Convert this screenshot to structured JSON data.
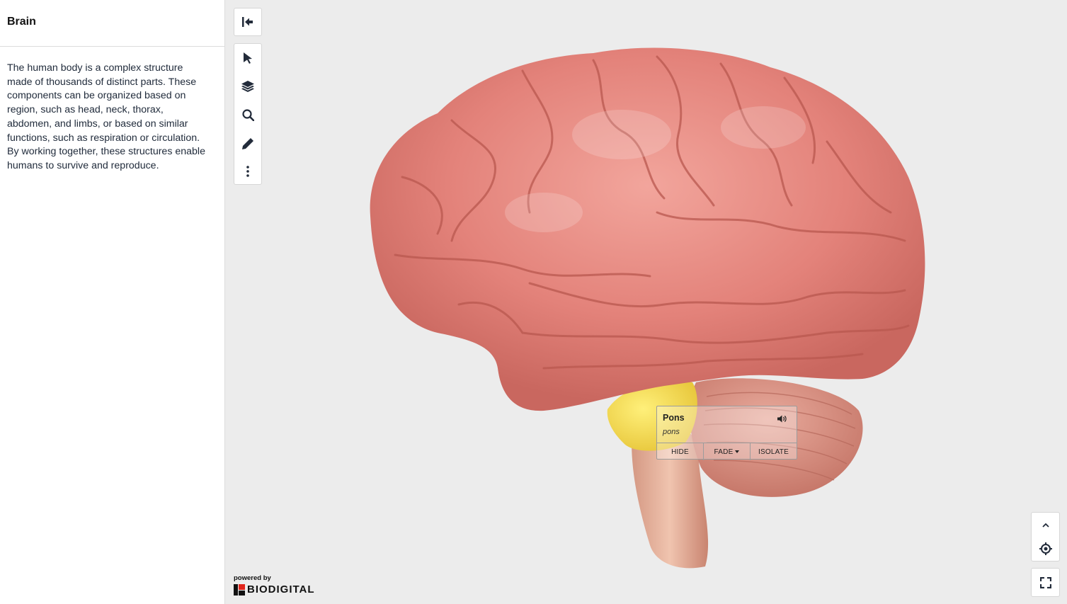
{
  "sidebar": {
    "title": "Brain",
    "description": "The human body is a complex structure made of thousands of distinct parts. These components can be organized based on region, such as head, neck, thorax, abdomen, and limbs, or based on similar functions, such as respiration or circulation. By working together, these structures enable humans to survive and reproduce."
  },
  "toolbar": {
    "collapse_icon": "collapse-left-icon",
    "tools": [
      "select-arrow-icon",
      "layers-icon",
      "search-icon",
      "pencil-icon",
      "more-vertical-icon"
    ]
  },
  "label": {
    "name": "Pons",
    "latin": "pons",
    "audio_icon": "speaker-icon",
    "actions": {
      "hide": "HIDE",
      "fade": "FADE",
      "isolate": "ISOLATE"
    }
  },
  "branding": {
    "powered_by": "powered by",
    "name": "BIODIGITAL"
  },
  "nav": {
    "expand_icon": "chevron-up-icon",
    "center_icon": "crosshair-icon",
    "fullscreen_icon": "fullscreen-icon"
  },
  "colors": {
    "brain": "#e9877f",
    "pons_highlight": "#f2df57",
    "cerebellum": "#d9897a",
    "icon": "#222b3a"
  }
}
